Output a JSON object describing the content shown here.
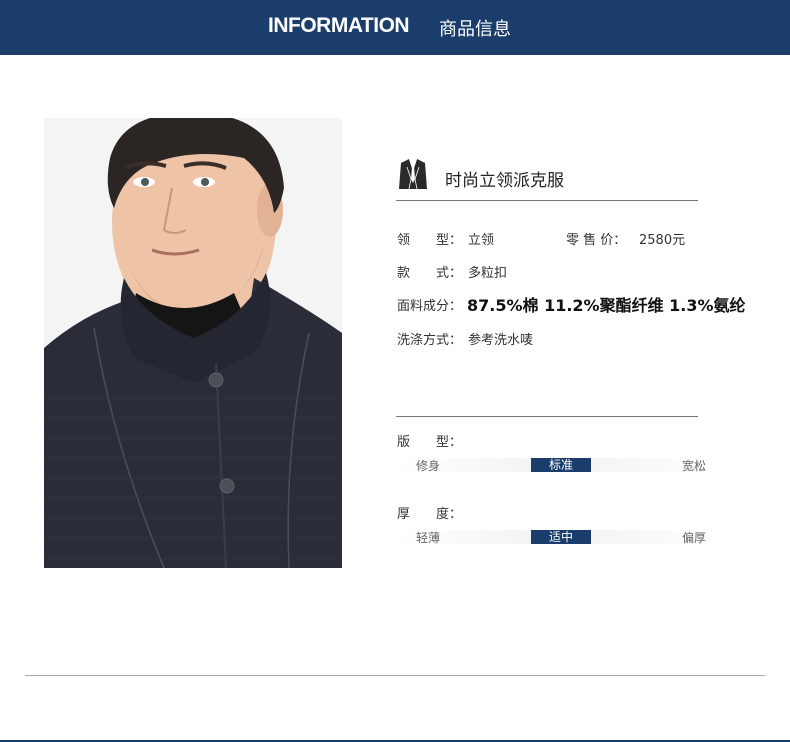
{
  "header": {
    "title_en": "INFORMATION",
    "title_cn": "商品信息"
  },
  "product": {
    "image_alt": "man wearing dark stand-collar knit jacket",
    "icon": "suit-icon",
    "name": "时尚立领派克服",
    "collar_label": "领　　型：",
    "collar_value": "立领",
    "price_label": "零 售 价：",
    "price_value": "2580元",
    "style_label": "款　　式：",
    "style_value": "多粒扣",
    "fabric_label": "面料成分：",
    "fabric_value": "87.5%棉 11.2%聚酯纤维 1.3%氨纶",
    "wash_label": "洗涤方式：",
    "wash_value": "参考洗水唛"
  },
  "fit": {
    "label": "版　　型：",
    "options": [
      "修身",
      "标准",
      "宽松"
    ],
    "selected": "标准"
  },
  "thickness": {
    "label": "厚　　度：",
    "options": [
      "轻薄",
      "适中",
      "偏厚"
    ],
    "selected": "适中"
  },
  "colors": {
    "brand": "#1b3d6b"
  }
}
